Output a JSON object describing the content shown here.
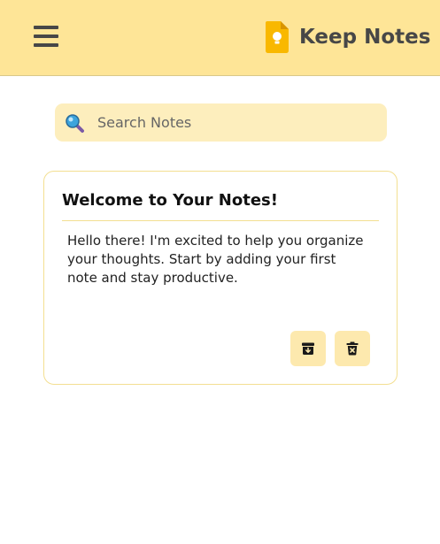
{
  "header": {
    "title": "Keep Notes",
    "menu_icon": "hamburger-menu-icon",
    "logo_icon": "keep-bulb-icon"
  },
  "search": {
    "placeholder": "Search Notes",
    "value": "",
    "icon": "magnifier-icon"
  },
  "note": {
    "title": "Welcome to Your Notes!",
    "body": "Hello there! I'm excited to help you organize your thoughts. Start by adding your first note and stay productive.",
    "actions": [
      {
        "icon": "archive-icon"
      },
      {
        "icon": "trash-icon"
      }
    ]
  },
  "colors": {
    "header_bg": "#fee597",
    "search_bg": "#fdeebd",
    "card_border": "#f3df91",
    "button_bg": "#fde9ae",
    "logo_yellow": "#f9b800"
  }
}
